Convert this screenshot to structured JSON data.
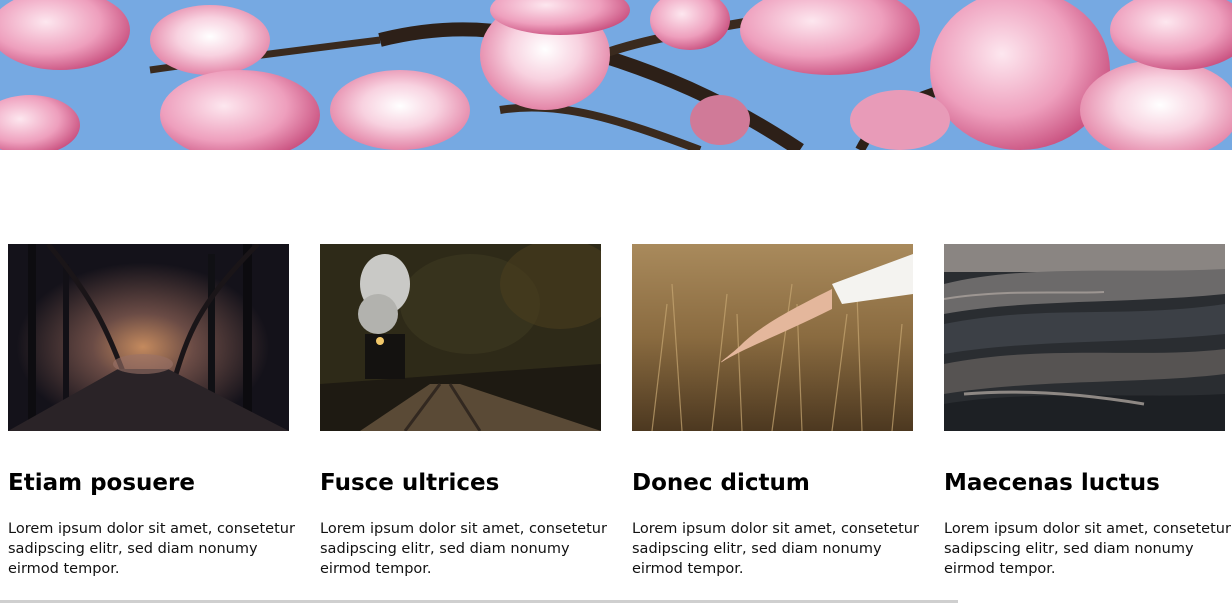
{
  "hero": {
    "image_icon": "magnolia-blossom-photo",
    "colors": {
      "sky": "#8cbcf0",
      "petal": "#f3a6c4",
      "branch": "#3a2a1e"
    }
  },
  "cards": [
    {
      "title": "Etiam posuere",
      "text": "Lorem ipsum dolor sit amet, consetetur sadipscing elitr, sed diam nonumy eirmod tempor.",
      "image_icon": "dark-forest-path-photo"
    },
    {
      "title": "Fusce ultrices",
      "text": "Lorem ipsum dolor sit amet, consetetur sadipscing elitr, sed diam nonumy eirmod tempor.",
      "image_icon": "steam-train-forest-photo"
    },
    {
      "title": "Donec dictum",
      "text": "Lorem ipsum dolor sit amet, consetetur sadipscing elitr, sed diam nonumy eirmod tempor.",
      "image_icon": "hand-wheat-field-photo"
    },
    {
      "title": "Maecenas luctus",
      "text": "Lorem ipsum dolor sit amet, consetetur sadipscing elitr, sed diam nonumy eirmod tempor.",
      "image_icon": "layered-rock-photo"
    }
  ]
}
